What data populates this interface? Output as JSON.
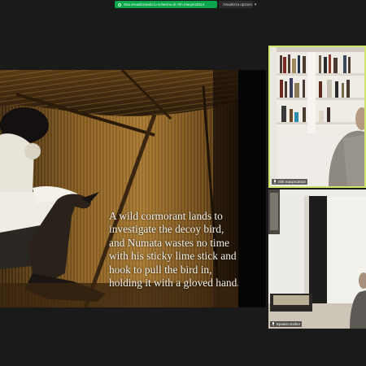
{
  "share_banner": {
    "text": "Stai visualizzando lo schermo di nhh macpro2014",
    "view_options_label": "Visualizza opzioni",
    "accent_color": "#0aa64b"
  },
  "slide": {
    "caption": "A wild cormorant lands to investigate the decoy bird, and Numata wastes no time with his sticky lime stick and hook to pull the bird in, holding it with a gloved hand."
  },
  "participants": [
    {
      "name": "nhh macpro2014",
      "active_speaker": true,
      "active_color": "#cfe46a"
    },
    {
      "name": "Epstein Esther",
      "active_speaker": false
    }
  ],
  "icons": [
    "share-status-icon",
    "chevron-down-icon",
    "mic-icon"
  ]
}
